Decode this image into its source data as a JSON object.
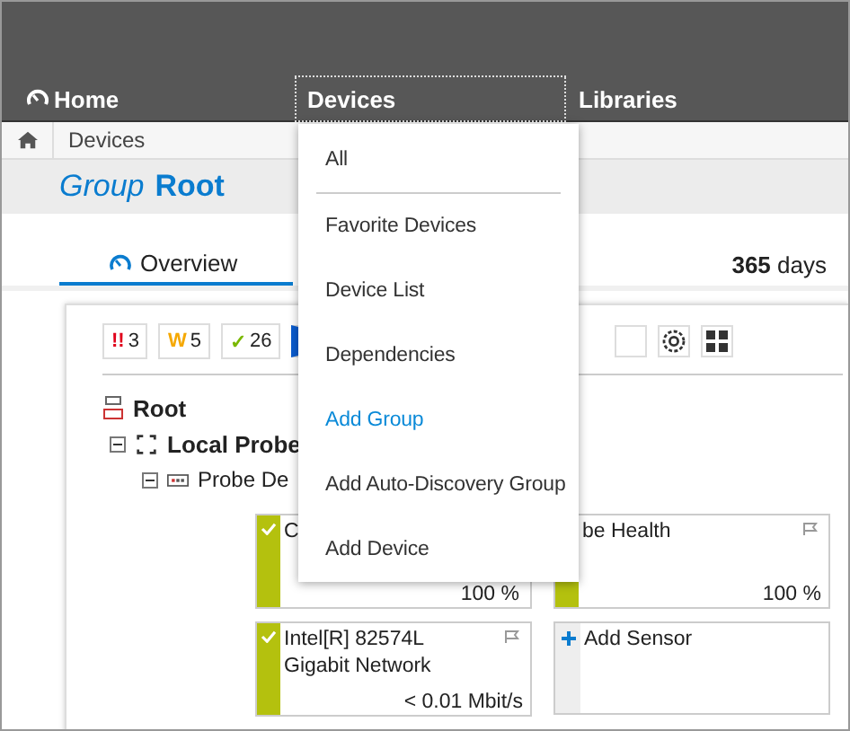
{
  "nav": [
    {
      "label": "Home",
      "selected": false
    },
    {
      "label": "Devices",
      "selected": true
    },
    {
      "label": "Libraries",
      "selected": false
    }
  ],
  "breadcrumb": [
    "Devices"
  ],
  "heading": {
    "kind_word": "Group",
    "name": "Root"
  },
  "tabs": [
    {
      "label": "Overview",
      "selected": true
    }
  ],
  "period": {
    "number": "365",
    "unit": "days"
  },
  "status_counts": [
    {
      "symbol": "!!",
      "count": "3",
      "color": "#e0001b"
    },
    {
      "symbol": "W",
      "count": "5",
      "color": "#f5a800"
    },
    {
      "symbol": "✓",
      "count": "26",
      "color": "#7ab800"
    }
  ],
  "tree": {
    "label": "Root",
    "children": [
      {
        "label": "Local Probe",
        "expanded": true,
        "children": [
          {
            "label": "Probe De",
            "expanded": true,
            "sensors": [
              {
                "kind": "sensor",
                "name": "C",
                "value": "100 %",
                "ok": true,
                "check": true,
                "flag": false
              },
              {
                "kind": "sensor",
                "name": "be Health",
                "value": "100 %",
                "ok": true,
                "check": false,
                "flag": true
              },
              {
                "kind": "sensor",
                "name": "Intel[R] 82574L Gigabit Network",
                "value": "< 0.01 Mbit/s",
                "ok": true,
                "check": true,
                "flag": true
              },
              {
                "kind": "add",
                "name": "Add Sensor"
              }
            ]
          }
        ]
      }
    ]
  },
  "dropdown": [
    {
      "label": "All",
      "divider_after": true,
      "highlighted": false
    },
    {
      "label": "Favorite Devices",
      "divider_after": false,
      "highlighted": false
    },
    {
      "label": "Device List",
      "divider_after": false,
      "highlighted": false
    },
    {
      "label": "Dependencies",
      "divider_after": false,
      "highlighted": false
    },
    {
      "label": "Add Group",
      "divider_after": false,
      "highlighted": true
    },
    {
      "label": "Add Auto-Discovery Group",
      "divider_after": false,
      "highlighted": false
    },
    {
      "label": "Add Device",
      "divider_after": false,
      "highlighted": false
    }
  ]
}
